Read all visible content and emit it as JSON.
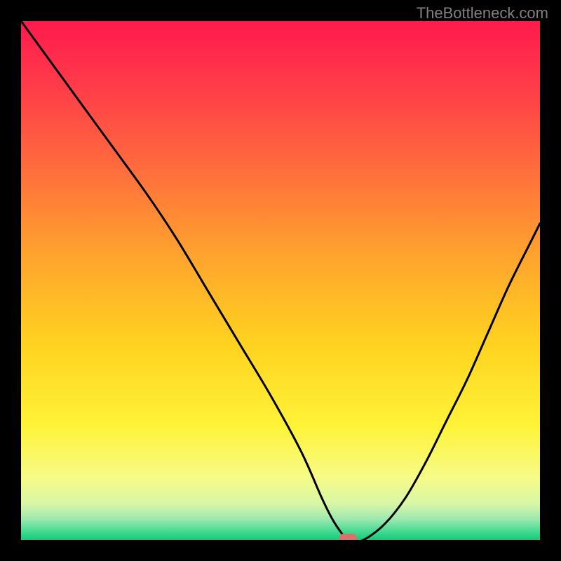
{
  "watermark": "TheBottleneck.com",
  "chart_data": {
    "type": "line",
    "title": "",
    "xlabel": "",
    "ylabel": "",
    "xlim": [
      0,
      100
    ],
    "ylim": [
      0,
      100
    ],
    "series": [
      {
        "name": "curve",
        "x": [
          0,
          8,
          16,
          24,
          30,
          36,
          42,
          48,
          54,
          58,
          60,
          62,
          63,
          64,
          66,
          70,
          74,
          78,
          82,
          86,
          90,
          94,
          98,
          100
        ],
        "values": [
          100,
          89,
          78,
          67,
          58,
          48,
          38,
          28,
          17,
          8,
          4,
          1,
          0,
          0,
          0,
          3,
          8,
          15,
          23,
          31,
          40,
          49,
          57,
          61
        ]
      }
    ],
    "marker": {
      "x": 63,
      "y": 0,
      "color": "#d9736a"
    },
    "gradient_stops": [
      {
        "offset": 0.0,
        "color": "#ff1a4d"
      },
      {
        "offset": 0.12,
        "color": "#ff3a4a"
      },
      {
        "offset": 0.28,
        "color": "#ff6b3d"
      },
      {
        "offset": 0.45,
        "color": "#ffa32e"
      },
      {
        "offset": 0.62,
        "color": "#ffd21f"
      },
      {
        "offset": 0.78,
        "color": "#fff338"
      },
      {
        "offset": 0.88,
        "color": "#f6fb88"
      },
      {
        "offset": 0.93,
        "color": "#d9f7a6"
      },
      {
        "offset": 0.96,
        "color": "#9de8b0"
      },
      {
        "offset": 0.985,
        "color": "#3fd98f"
      },
      {
        "offset": 1.0,
        "color": "#15c97a"
      }
    ]
  }
}
